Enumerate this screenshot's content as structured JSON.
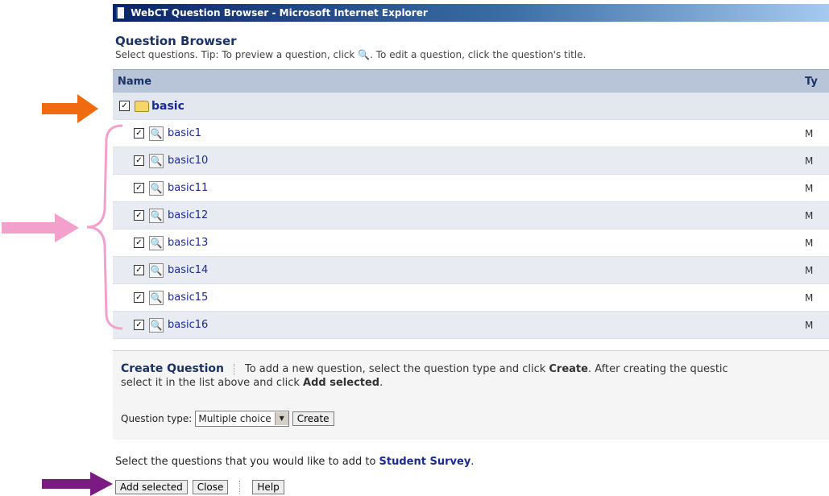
{
  "window": {
    "title": "WebCT Question Browser - Microsoft Internet Explorer"
  },
  "header": {
    "title": "Question Browser",
    "tip_before": "Select questions. Tip: To preview a question, click ",
    "tip_icon": "🔍",
    "tip_after": ". To edit a question, click the question's title."
  },
  "grid": {
    "col_name": "Name",
    "col_type": "Ty",
    "folder": {
      "label": "basic",
      "checked": "✓"
    },
    "rows": [
      {
        "name": "basic1",
        "type": "M"
      },
      {
        "name": "basic10",
        "type": "M"
      },
      {
        "name": "basic11",
        "type": "M"
      },
      {
        "name": "basic12",
        "type": "M"
      },
      {
        "name": "basic13",
        "type": "M"
      },
      {
        "name": "basic14",
        "type": "M"
      },
      {
        "name": "basic15",
        "type": "M"
      },
      {
        "name": "basic16",
        "type": "M"
      }
    ],
    "check_mark": "✓",
    "magnifier": "🔍"
  },
  "create": {
    "heading": "Create Question",
    "line1_before": "To add a new question, select the question type and click ",
    "line1_bold": "Create",
    "line1_after": ". After creating the questic",
    "line2_before": "select it in the list above and click ",
    "line2_bold": "Add selected",
    "line2_after": ".",
    "qtype_label": "Question type:",
    "qtype_value": "Multiple choice",
    "create_button": "Create"
  },
  "footer": {
    "text_before": "Select the questions that you would like to add to ",
    "text_bold": "Student Survey",
    "text_after": ".",
    "add_selected": "Add selected",
    "close": "Close",
    "help": "Help"
  },
  "annotations": {
    "orange": "#f06a10",
    "pink": "#f4a0cc",
    "purple": "#7a1a82"
  }
}
